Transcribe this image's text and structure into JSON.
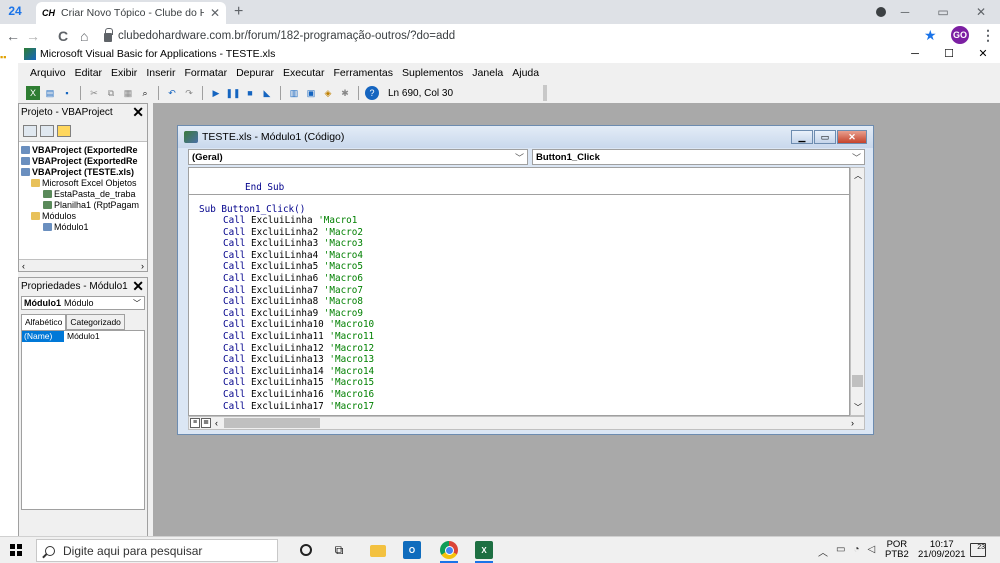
{
  "browser": {
    "tab_count": "24",
    "tab_favicon": "CH",
    "tab_title": "Criar Novo Tópico - Clube do Ha",
    "tab_close": "✕",
    "new_tab": "+",
    "url": "clubedohardware.com.br/forum/182-programação-outros/?do=add",
    "profile_initials": "GO",
    "nav": {
      "back": "←",
      "forward": "→",
      "reload": "C",
      "home": "⌂"
    },
    "controls": {
      "minimize": "─",
      "maximize": "▭",
      "close": "✕"
    }
  },
  "vba": {
    "title": "Microsoft Visual Basic for Applications - TESTE.xls",
    "menu": [
      "Arquivo",
      "Editar",
      "Exibir",
      "Inserir",
      "Formatar",
      "Depurar",
      "Executar",
      "Ferramentas",
      "Suplementos",
      "Janela",
      "Ajuda"
    ],
    "toolbar_position": "Ln 690, Col 30",
    "controls": {
      "minimize": "─",
      "maximize": "☐",
      "close": "✕"
    }
  },
  "project_pane": {
    "title": "Projeto - VBAProject",
    "close": "✕",
    "tree": [
      {
        "label": "VBAProject (ExportedRe",
        "bold": true
      },
      {
        "label": "VBAProject (ExportedRe",
        "bold": true
      },
      {
        "label": "VBAProject (TESTE.xls)",
        "bold": true
      },
      {
        "label": "Microsoft Excel Objetos",
        "bold": false
      },
      {
        "label": "EstaPasta_de_traba",
        "bold": false
      },
      {
        "label": "Planilha1 (RptPagam",
        "bold": false
      },
      {
        "label": "Módulos",
        "bold": false
      },
      {
        "label": "Módulo1",
        "bold": false
      }
    ]
  },
  "properties_pane": {
    "title": "Propriedades - Módulo1",
    "close": "✕",
    "object_name": "Módulo1",
    "object_type": "Módulo",
    "tabs": [
      "Alfabético",
      "Categorizado"
    ],
    "row_name": "(Name)",
    "row_value": "Módulo1"
  },
  "code_window": {
    "title": "TESTE.xls - Módulo1 (Código)",
    "object_combo": "(Geral)",
    "proc_combo": "Button1_Click",
    "end_sub": "End Sub",
    "sub_decl": "Sub Button1_Click()",
    "call_keyword": "Call",
    "lines": [
      {
        "proc": "ExcluiLinha",
        "comment": "'Macro1"
      },
      {
        "proc": "ExcluiLinha2",
        "comment": "'Macro2"
      },
      {
        "proc": "ExcluiLinha3",
        "comment": "'Macro3"
      },
      {
        "proc": "ExcluiLinha4",
        "comment": "'Macro4"
      },
      {
        "proc": "ExcluiLinha5",
        "comment": "'Macro5"
      },
      {
        "proc": "ExcluiLinha6",
        "comment": "'Macro6"
      },
      {
        "proc": "ExcluiLinha7",
        "comment": "'Macro7"
      },
      {
        "proc": "ExcluiLinha8",
        "comment": "'Macro8"
      },
      {
        "proc": "ExcluiLinha9",
        "comment": "'Macro9"
      },
      {
        "proc": "ExcluiLinha10",
        "comment": "'Macro10"
      },
      {
        "proc": "ExcluiLinha11",
        "comment": "'Macro11"
      },
      {
        "proc": "ExcluiLinha12",
        "comment": "'Macro12"
      },
      {
        "proc": "ExcluiLinha13",
        "comment": "'Macro13"
      },
      {
        "proc": "ExcluiLinha14",
        "comment": "'Macro14"
      },
      {
        "proc": "ExcluiLinha15",
        "comment": "'Macro15"
      },
      {
        "proc": "ExcluiLinha16",
        "comment": "'Macro16"
      },
      {
        "proc": "ExcluiLinha17",
        "comment": "'Macro17"
      }
    ]
  },
  "taskbar": {
    "search_placeholder": "Digite aqui para pesquisar",
    "lang_top": "POR",
    "lang_bottom": "PTB2",
    "time": "10:17",
    "date": "21/09/2021",
    "notification_count": "23"
  }
}
